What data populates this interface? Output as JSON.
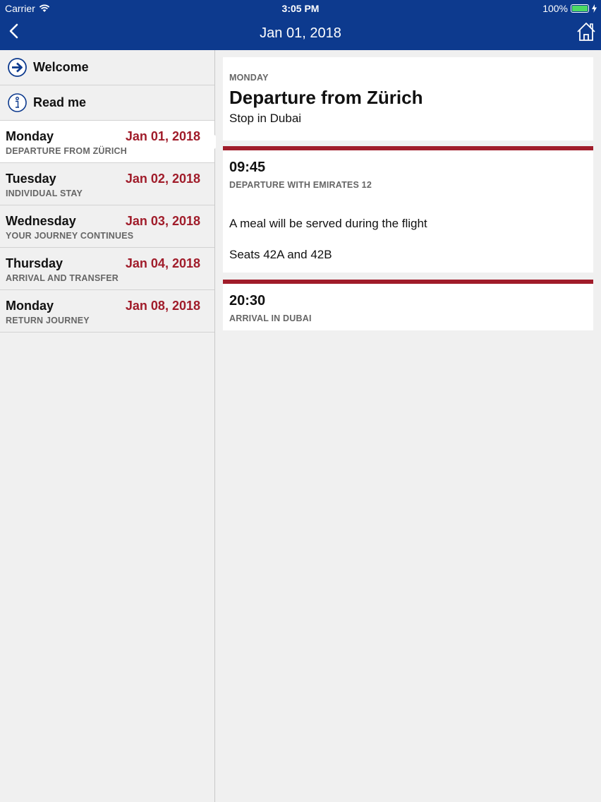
{
  "status_bar": {
    "carrier": "Carrier",
    "time": "3:05 PM",
    "battery": "100%"
  },
  "nav": {
    "title": "Jan 01, 2018"
  },
  "sidebar": {
    "links": [
      {
        "label": "Welcome",
        "icon": "arrow-right-circle-icon"
      },
      {
        "label": "Read me",
        "icon": "info-circle-icon"
      }
    ],
    "days": [
      {
        "day": "Monday",
        "date": "Jan 01, 2018",
        "subtitle": "DEPARTURE FROM ZÜRICH"
      },
      {
        "day": "Tuesday",
        "date": "Jan 02, 2018",
        "subtitle": "INDIVIDUAL STAY"
      },
      {
        "day": "Wednesday",
        "date": "Jan 03, 2018",
        "subtitle": "YOUR JOURNEY CONTINUES"
      },
      {
        "day": "Thursday",
        "date": "Jan 04, 2018",
        "subtitle": "ARRIVAL AND TRANSFER"
      },
      {
        "day": "Monday",
        "date": "Jan 08, 2018",
        "subtitle": "RETURN JOURNEY"
      }
    ]
  },
  "detail": {
    "weekday": "MONDAY",
    "title": "Departure from Zürich",
    "subtitle": "Stop in Dubai",
    "events": [
      {
        "time": "09:45",
        "label": "DEPARTURE WITH EMIRATES 12",
        "notes": [
          "A meal will be served during the flight",
          "Seats 42A and 42B"
        ]
      },
      {
        "time": "20:30",
        "label": "ARRIVAL IN DUBAI",
        "notes": []
      }
    ]
  },
  "colors": {
    "nav_bg": "#0d3a8e",
    "accent_red": "#a01c2a",
    "battery_green": "#4cd964"
  }
}
